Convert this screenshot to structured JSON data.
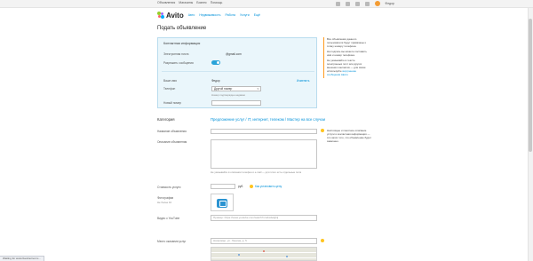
{
  "topbar": {
    "links": [
      "Объявления",
      "Магазины",
      "Бизнес",
      "Помощь"
    ],
    "user_name": "Федор",
    "icons": [
      "star-icon",
      "heart-icon",
      "mail-icon",
      "bell-icon"
    ]
  },
  "header": {
    "logo": "Avito",
    "nav": [
      "Авто",
      "Недвижимость",
      "Работа",
      "Услуги",
      "Ещё"
    ]
  },
  "page_title": "Подать объявление",
  "contact": {
    "title": "Контактная информация",
    "email_label": "Электронная почта",
    "email_value": "@gmail.com",
    "messages_label": "Разрешить сообщения",
    "name_label": "Ваше имя",
    "name_value": "Федор",
    "change_link": "Изменить",
    "city_label": "Телефон",
    "city_value": "Другой номер",
    "city_hint": "Номер подтвержден недавно",
    "extra_label": "Новый номер"
  },
  "side_note": {
    "p1": "Все объявления данного пользователя будут привязаны к этому номеру телефона.",
    "p2": "На подпись вы можете поставить имя и номер телефона.",
    "p3": "Не указывайте в тексте электронных почт или других внешних контактов — для связи используйте",
    "link": "внутренние сообщения Авито"
  },
  "form": {
    "category_label": "Категория",
    "category_value": "Предложение услуг / IT, интернет, телеком / Мастер на все случаи",
    "title_label": "Название объявления",
    "desc_label": "Описание объявления",
    "desc_hint": "Не указывайте в описании телефон и e-mail — для этого есть отдельные поля",
    "price_label": "Стоимость услуги",
    "price_link": "Как установить цену",
    "price_currency": "руб.",
    "photo_label": "Фотографии",
    "photo_sub": "Не более 10",
    "video_label": "Видео с YouTube",
    "video_placeholder": "Пример: https://www.youtube.com/watch?v=abcdefghij",
    "address_label": "Место оказания услуг",
    "address_placeholder": "Например, ул. Ленина, д. 5"
  },
  "tip": {
    "text": "Настоящее и понятное описание услуги и контактная информация — это залог того, что объявление будет замечено."
  },
  "status": {
    "text": "Waiting for www.liveinternet.ru..."
  },
  "colors": {
    "accent": "#0091d9",
    "box_bg": "#eaf6fb",
    "orange": "#ff9c20",
    "toggle": "#2aa3d9"
  }
}
